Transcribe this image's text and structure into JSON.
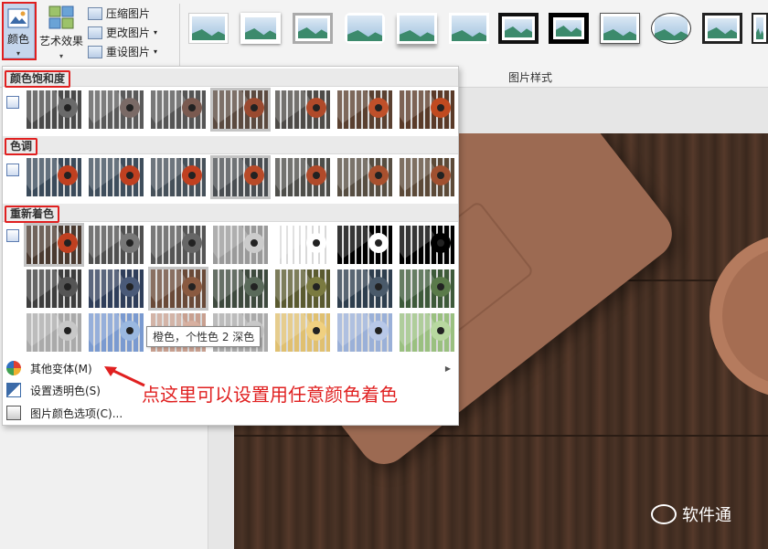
{
  "ribbon": {
    "color_label": "颜色",
    "art_effects_label": "艺术效果",
    "compress_label": "压缩图片",
    "change_label": "更改图片",
    "reset_label": "重设图片",
    "group_label": "图片样式"
  },
  "dropdown": {
    "sections": [
      {
        "title": "颜色饱和度"
      },
      {
        "title": "色调"
      },
      {
        "title": "重新着色"
      }
    ],
    "menu": [
      {
        "label": "其他变体(M)"
      },
      {
        "label": "设置透明色(S)"
      },
      {
        "label": "图片颜色选项(C)..."
      }
    ],
    "tooltip": "橙色，个性色 2 深色"
  },
  "annotation": {
    "text": "点这里可以设置用任意颜色着色"
  },
  "watermark": {
    "text": "软件通"
  },
  "colors": {
    "accent_red": "#e02020",
    "selected_blue": "#c5d6ec"
  }
}
